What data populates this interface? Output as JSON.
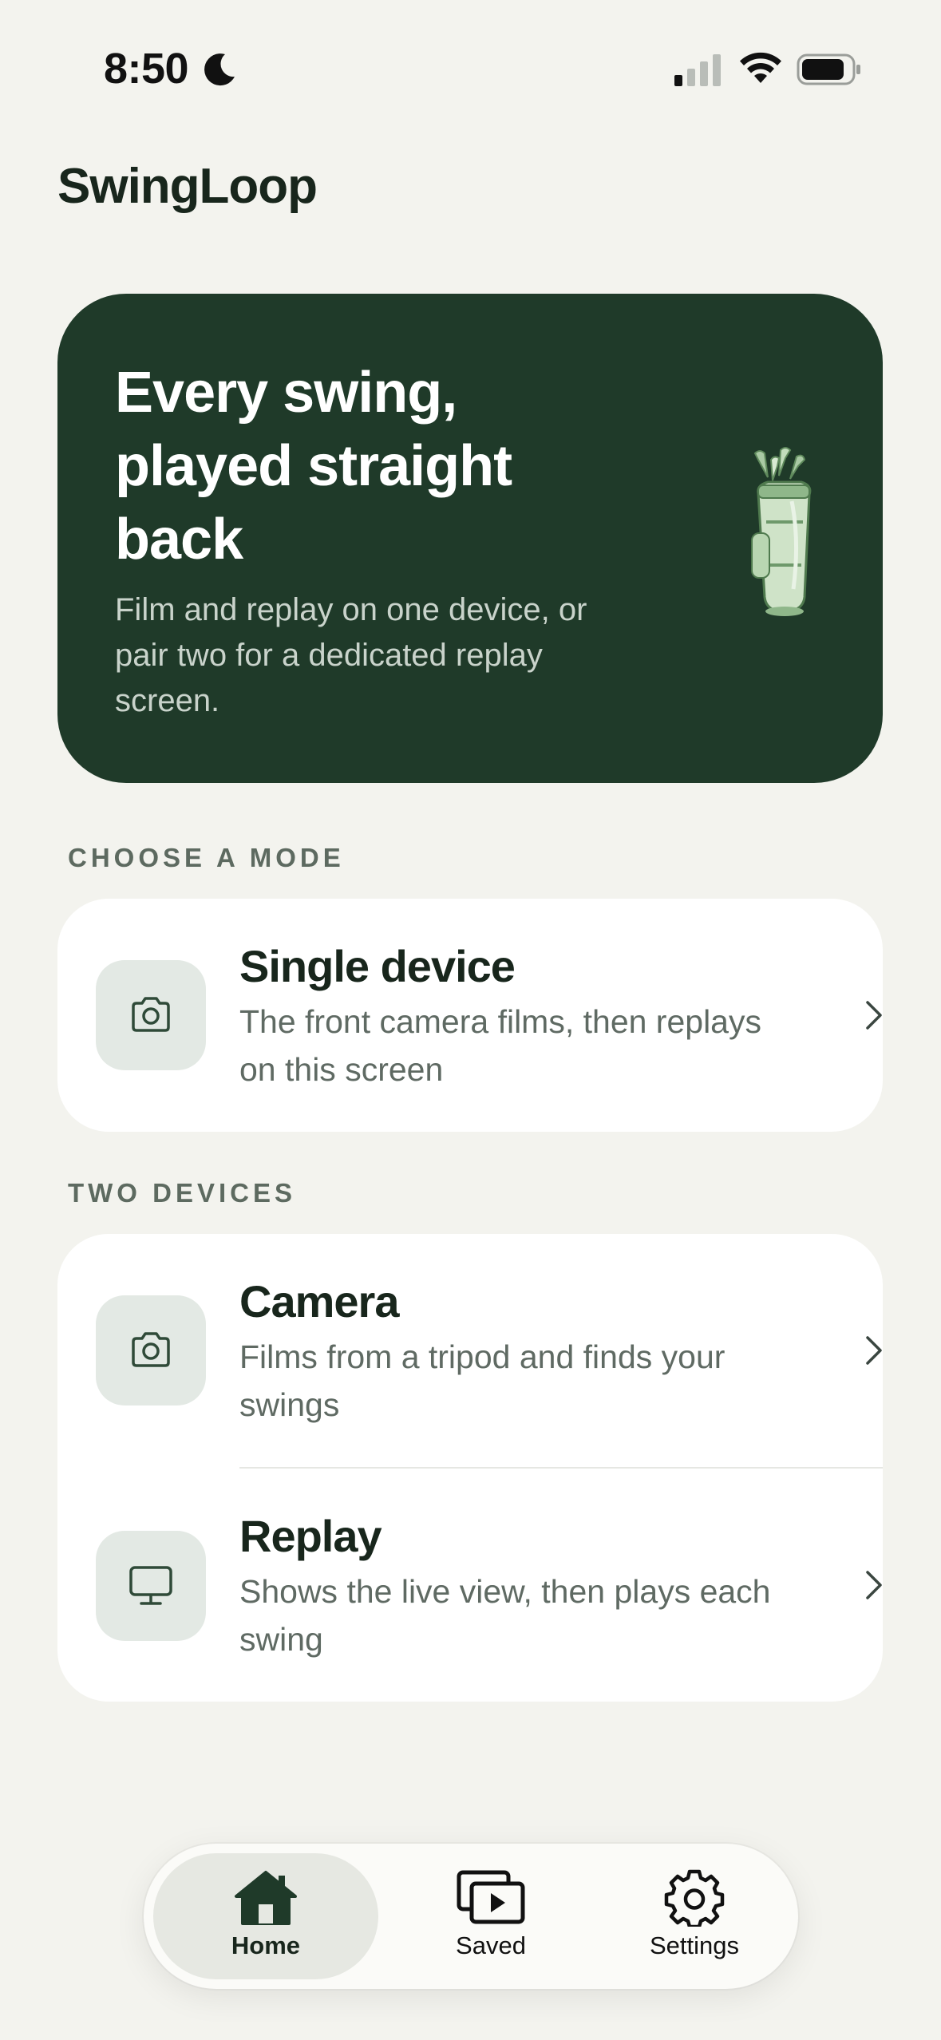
{
  "status_bar": {
    "time": "8:50",
    "icons": [
      "moon-icon",
      "cellular-signal-icon",
      "wifi-icon",
      "battery-icon"
    ]
  },
  "app": {
    "title": "SwingLoop"
  },
  "hero": {
    "headline": "Every swing, played straight back",
    "subtitle": "Film and replay on one device, or pair two for a dedicated replay screen.",
    "illustration": "golf-bag-icon"
  },
  "sections": {
    "mode_label": "CHOOSE A MODE",
    "two_devices_label": "TWO DEVICES"
  },
  "modes": {
    "single": {
      "title": "Single device",
      "description": "The front camera films, then replays on this screen",
      "icon": "camera-icon"
    },
    "camera": {
      "title": "Camera",
      "description": "Films from a tripod and finds your swings",
      "icon": "camera-icon"
    },
    "replay": {
      "title": "Replay",
      "description": "Shows the live view, then plays each swing",
      "icon": "monitor-icon"
    }
  },
  "tab_bar": {
    "tabs": [
      {
        "label": "Home",
        "icon": "home-icon",
        "active": true
      },
      {
        "label": "Saved",
        "icon": "saved-videos-icon",
        "active": false
      },
      {
        "label": "Settings",
        "icon": "gear-icon",
        "active": false
      }
    ]
  },
  "colors": {
    "background": "#f3f3ee",
    "hero": "#1f3a29",
    "accent_dark_green": "#18261c",
    "icon_box": "#e3e9e4"
  }
}
